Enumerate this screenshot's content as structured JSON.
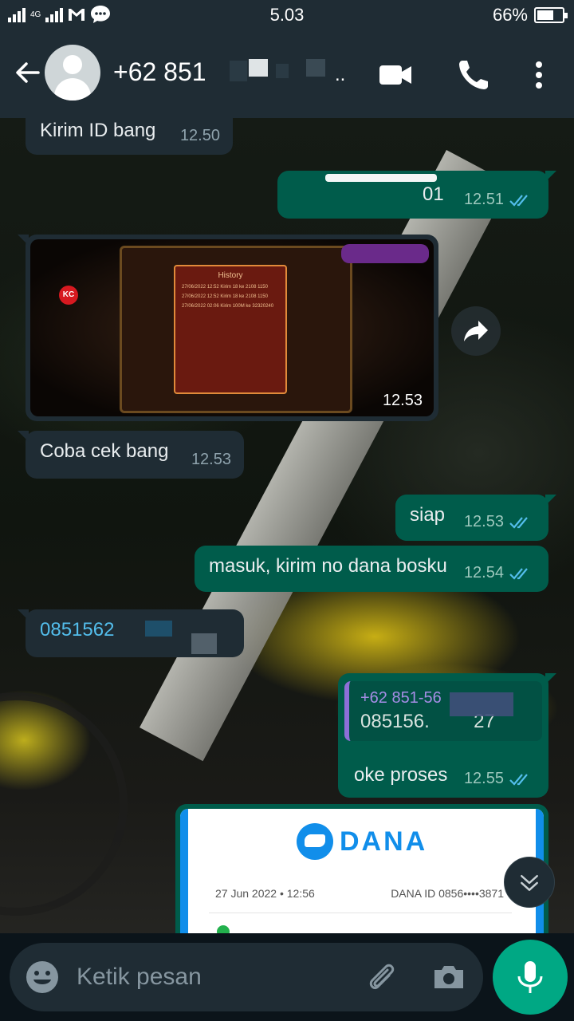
{
  "status_bar": {
    "network": "4G",
    "time": "5.03",
    "battery_percent": "66%",
    "battery_level": 0.66
  },
  "header": {
    "contact": "+62 851",
    "contact_trailing": ".."
  },
  "messages": [
    {
      "dir": "in",
      "text": "Kirim ID bang",
      "time": "12.50"
    },
    {
      "dir": "out",
      "text": " 01",
      "time": "12.51",
      "ticks": "read"
    },
    {
      "dir": "in",
      "type": "image",
      "time": "12.53",
      "image_title": "History",
      "image_rows": [
        "27/06/2022 12:52  Kirim 18 ke 2108 1150",
        "27/06/2022 12:52  Kirim 18 ke 2108 1150",
        "27/06/2022 02:06  Kirim 100M ke 32320240"
      ],
      "image_badge": "KC"
    },
    {
      "dir": "in",
      "text": "Coba cek bang",
      "time": "12.53"
    },
    {
      "dir": "out",
      "text": "siap",
      "time": "12.53",
      "ticks": "read"
    },
    {
      "dir": "out",
      "text": "masuk, kirim no dana bosku",
      "time": "12.54",
      "ticks": "read"
    },
    {
      "dir": "in",
      "text": "0851562",
      "link": true
    },
    {
      "dir": "out",
      "type": "reply",
      "reply_name": "+62 851-56",
      "reply_text": "085156.",
      "reply_text_end": "27",
      "text": "oke proses",
      "time": "12.55",
      "ticks": "read"
    },
    {
      "dir": "out",
      "type": "image",
      "brand": "DANA",
      "date": "27 Jun 2022 • 12:56",
      "dana_id": "DANA ID 0856••••3871"
    }
  ],
  "composer": {
    "placeholder": "Ketik pesan"
  },
  "colors": {
    "header_bg": "#1f2c34",
    "incoming_bubble": "#1f2c34",
    "outgoing_bubble": "#005c4b",
    "accent": "#00a884",
    "read_ticks": "#53bdeb",
    "dana_blue": "#118eea"
  },
  "icons": [
    "back-arrow-icon",
    "avatar-icon",
    "video-call-icon",
    "phone-icon",
    "more-vert-icon",
    "share-icon",
    "scroll-down-icon",
    "emoji-icon",
    "attach-icon",
    "camera-icon",
    "mic-icon"
  ]
}
